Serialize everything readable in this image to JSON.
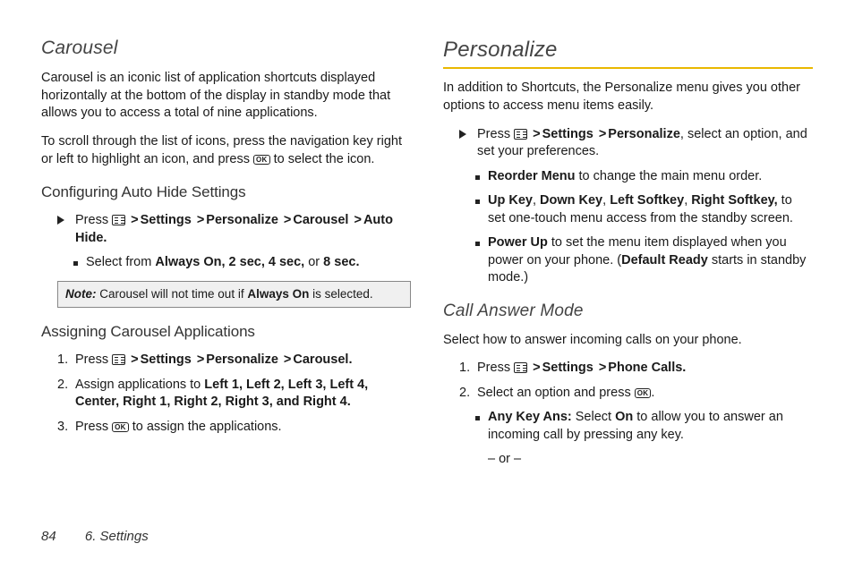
{
  "left": {
    "title": "Carousel",
    "intro1": "Carousel is an iconic list of application shortcuts displayed horizontally at the bottom of the display in standby mode that allows you to access a total of nine applications.",
    "intro2_a": "To scroll through the list of icons, press the navigation key right or left to highlight an icon, and press ",
    "intro2_b": " to select the icon.",
    "sub1": "Configuring Auto Hide Settings",
    "step1_a": "Press ",
    "gt": ">",
    "path_settings": "Settings",
    "path_personalize": "Personalize",
    "path_carousel": "Carousel",
    "path_autohide": "Auto Hide.",
    "bullet1_a": "Select from ",
    "bullet1_b": "Always On, 2 sec, 4 sec,",
    "bullet1_c": " or ",
    "bullet1_d": "8 sec.",
    "note_label": "Note:",
    "note_a": " Carousel will not time out if ",
    "note_b": "Always On",
    "note_c": " is selected.",
    "sub2": "Assigning Carousel Applications",
    "ol1_num": "1.",
    "ol1_a": "Press ",
    "ol1_path_end": "Carousel.",
    "ol2_num": "2.",
    "ol2_a": "Assign applications to ",
    "ol2_b": "Left 1, Left 2, Left 3, Left 4, Center, Right 1, Right 2, Right 3, and Right 4.",
    "ol3_num": "3.",
    "ol3_a": "Press ",
    "ol3_b": " to assign the applications."
  },
  "right": {
    "title": "Personalize",
    "intro": "In addition to Shortcuts, the Personalize menu gives you other options to access menu items easily.",
    "step1_a": "Press ",
    "step1_end": ", select an option, and set your preferences.",
    "b1_a": "Reorder Menu",
    "b1_b": " to change the main menu order.",
    "b2_a": "Up Key",
    "b2_b": "Down Key",
    "b2_c": "Left Softkey",
    "b2_d": "Right  Softkey,",
    "b2_e": " to set one-touch menu access from the standby screen.",
    "b3_a": "Power Up",
    "b3_b": " to set the menu item displayed when you power on your phone. (",
    "b3_c": "Default Ready",
    "b3_d": " starts in standby mode.)",
    "sub2": "Call Answer Mode",
    "sub2_intro": "Select how to answer incoming calls on your phone.",
    "ol1_num": "1.",
    "ol1_a": "Press ",
    "path_phonecalls": "Phone Calls.",
    "ol2_num": "2.",
    "ol2_a": "Select an option and press ",
    "ol2_b": ".",
    "bb1_a": "Any Key Ans:",
    "bb1_b": " Select ",
    "bb1_c": "On",
    "bb1_d": " to allow you to answer an incoming call by pressing any key.",
    "or": "– or –"
  },
  "footer": {
    "page": "84",
    "chapter": "6. Settings"
  },
  "icons": {
    "ok": "OK"
  }
}
